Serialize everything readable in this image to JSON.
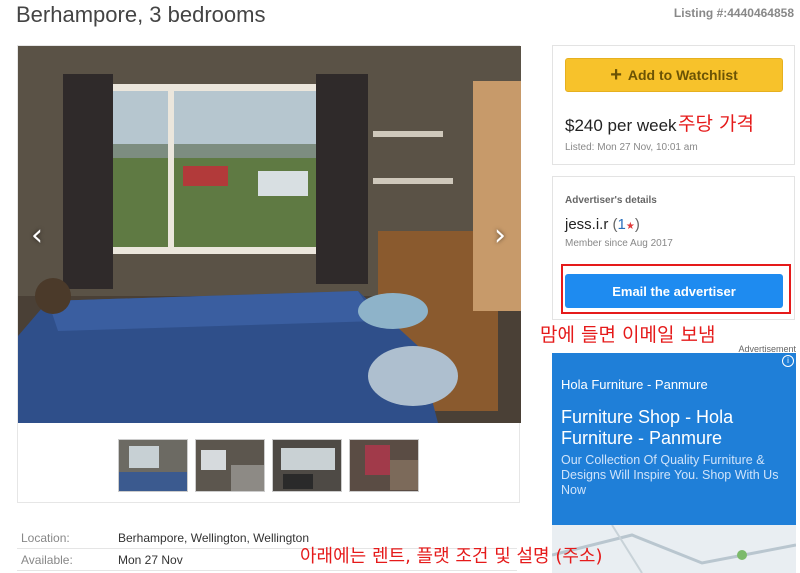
{
  "header": {
    "title": "Berhampore, 3 bedrooms",
    "listing_no": "Listing #:4440464858"
  },
  "gallery": {
    "prev_glyph": "‹",
    "next_glyph": "›",
    "thumbnails": [
      "thumb-bedroom",
      "thumb-kitchen",
      "thumb-living",
      "thumb-room"
    ]
  },
  "sidebar": {
    "watchlist_label": "Add to Watchlist",
    "price": "$240 per week",
    "listed": "Listed: Mon 27 Nov, 10:01 am",
    "advertiser_heading": "Advertiser's details",
    "advertiser_name": "jess.i.r",
    "rating_count": "1",
    "member_since": "Member since Aug 2017",
    "email_label": "Email the advertiser"
  },
  "ad": {
    "label": "Advertisement",
    "small_title": "Hola Furniture - Panmure",
    "title": "Furniture Shop - Hola Furniture - Panmure",
    "description": "Our Collection Of Quality Furniture & Designs Will Inspire You. Shop With Us Now",
    "icon": "i"
  },
  "details": [
    {
      "label": "Location:",
      "value": "Berhampore, Wellington, Wellington"
    },
    {
      "label": "Available:",
      "value": "Mon 27 Nov"
    }
  ],
  "annotations": {
    "price_note": "주당 가격",
    "email_note": "맘에 들면 이메일 보냄",
    "bottom_note": "아래에는 렌트, 플랫 조건 및 설명 (주소)"
  },
  "colors": {
    "watchlist": "#f7c22b",
    "email": "#1e8bf0",
    "annotation": "#e51a1a",
    "ad": "#1f7fd8"
  }
}
